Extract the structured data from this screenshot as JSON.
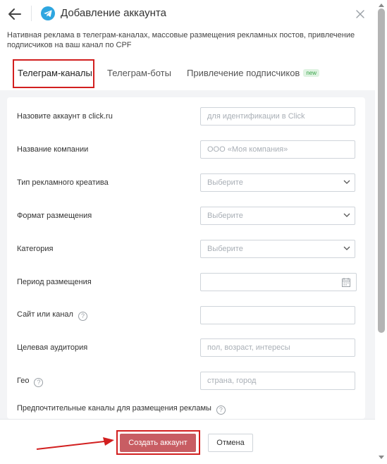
{
  "header": {
    "title": "Добавление аккаунта",
    "back_icon": "arrow-left-icon",
    "close_icon": "close-icon",
    "platform_icon": "telegram-icon"
  },
  "description": "Нативная реклама в телеграм-каналах, массовые размещения рекламных постов, привлечение подписчиков на ваш канал по CPF",
  "tabs": [
    {
      "label": "Телеграм-каналы",
      "active": true
    },
    {
      "label": "Телеграм-боты",
      "active": false
    },
    {
      "label": "Привлечение подписчиков",
      "active": false,
      "badge": "new"
    }
  ],
  "form": {
    "fields": [
      {
        "label": "Назовите аккаунт в click.ru",
        "placeholder": "для идентификации в Click",
        "type": "text"
      },
      {
        "label": "Название компании",
        "placeholder": "ООО «Моя компания»",
        "type": "text"
      },
      {
        "label": "Тип рекламного креатива",
        "value": "Выберите",
        "type": "select"
      },
      {
        "label": "Формат размещения",
        "value": "Выберите",
        "type": "select"
      },
      {
        "label": "Категория",
        "value": "Выберите",
        "type": "select"
      },
      {
        "label": "Период размещения",
        "placeholder": "",
        "type": "date"
      },
      {
        "label": "Сайт или канал",
        "placeholder": "",
        "type": "text",
        "help": "?"
      },
      {
        "label": "Целевая аудитория",
        "placeholder": "пол, возраст, интересы",
        "type": "text"
      },
      {
        "label": "Гео",
        "placeholder": "страна, город",
        "type": "text",
        "help": "?"
      }
    ],
    "last_label": "Предпочтительные каналы для размещения рекламы",
    "last_help": "?"
  },
  "footer": {
    "create_label": "Создать аккаунт",
    "cancel_label": "Отмена"
  },
  "colors": {
    "primary_button": "#c85d63",
    "highlight": "#d21f1f",
    "telegram": "#2ea6e0",
    "new_badge": "#3aa54a"
  }
}
